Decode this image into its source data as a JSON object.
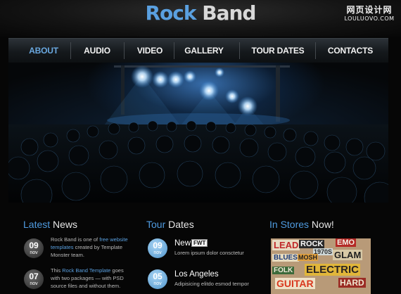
{
  "site_title": {
    "word1": "Rock",
    "word2": "Band"
  },
  "watermark": {
    "line1": "网页设计网",
    "line2": "LOULUOVO.COM"
  },
  "nav": [
    {
      "label": "ABOUT",
      "active": true
    },
    {
      "label": "AUDIO",
      "active": false
    },
    {
      "label": "VIDEO",
      "active": false
    },
    {
      "label": "GALLERY",
      "active": false
    },
    {
      "label": "TOUR DATES",
      "active": false
    },
    {
      "label": "CONTACTS",
      "active": false
    }
  ],
  "latest_news": {
    "title_accent": "Latest",
    "title_rest": "News",
    "items": [
      {
        "day": "09",
        "month": "nov",
        "t1": "Rock Band is one of ",
        "link1": "free website",
        "link2": "templates",
        "t2": " created by Template",
        "t3": "Monster team."
      },
      {
        "day": "07",
        "month": "nov",
        "t1": "This ",
        "link1": "Rock Band Template",
        "t2": " goes",
        "t3": "with two packages — with PSD",
        "t4": "source files and without them."
      }
    ]
  },
  "tour_dates": {
    "title_accent": "Tour",
    "title_rest": "Dates",
    "items": [
      {
        "day": "09",
        "month": "nov",
        "city": "New",
        "city_badge": "FWT",
        "sub": "Lorem ipsum dolor consctetur"
      },
      {
        "day": "05",
        "month": "nov",
        "city": "Los Angeles",
        "sub": "Adipisicing elitdo esmod tempor"
      }
    ]
  },
  "in_stores": {
    "title_accent": "In Stores",
    "title_rest": "Now!",
    "collage_words": [
      "LEAD",
      "ELECTRIC",
      "GUITAR",
      "HARD",
      "GLAM",
      "EMO",
      "1970S",
      "BLUES",
      "FOLK",
      "MOSH",
      "ROCK"
    ]
  },
  "colors": {
    "accent": "#4f9be0",
    "badge_blue": "#6aa8d8",
    "badge_dark": "#444444"
  },
  "hero": {
    "image": "concert-crowd-stage-lights"
  }
}
